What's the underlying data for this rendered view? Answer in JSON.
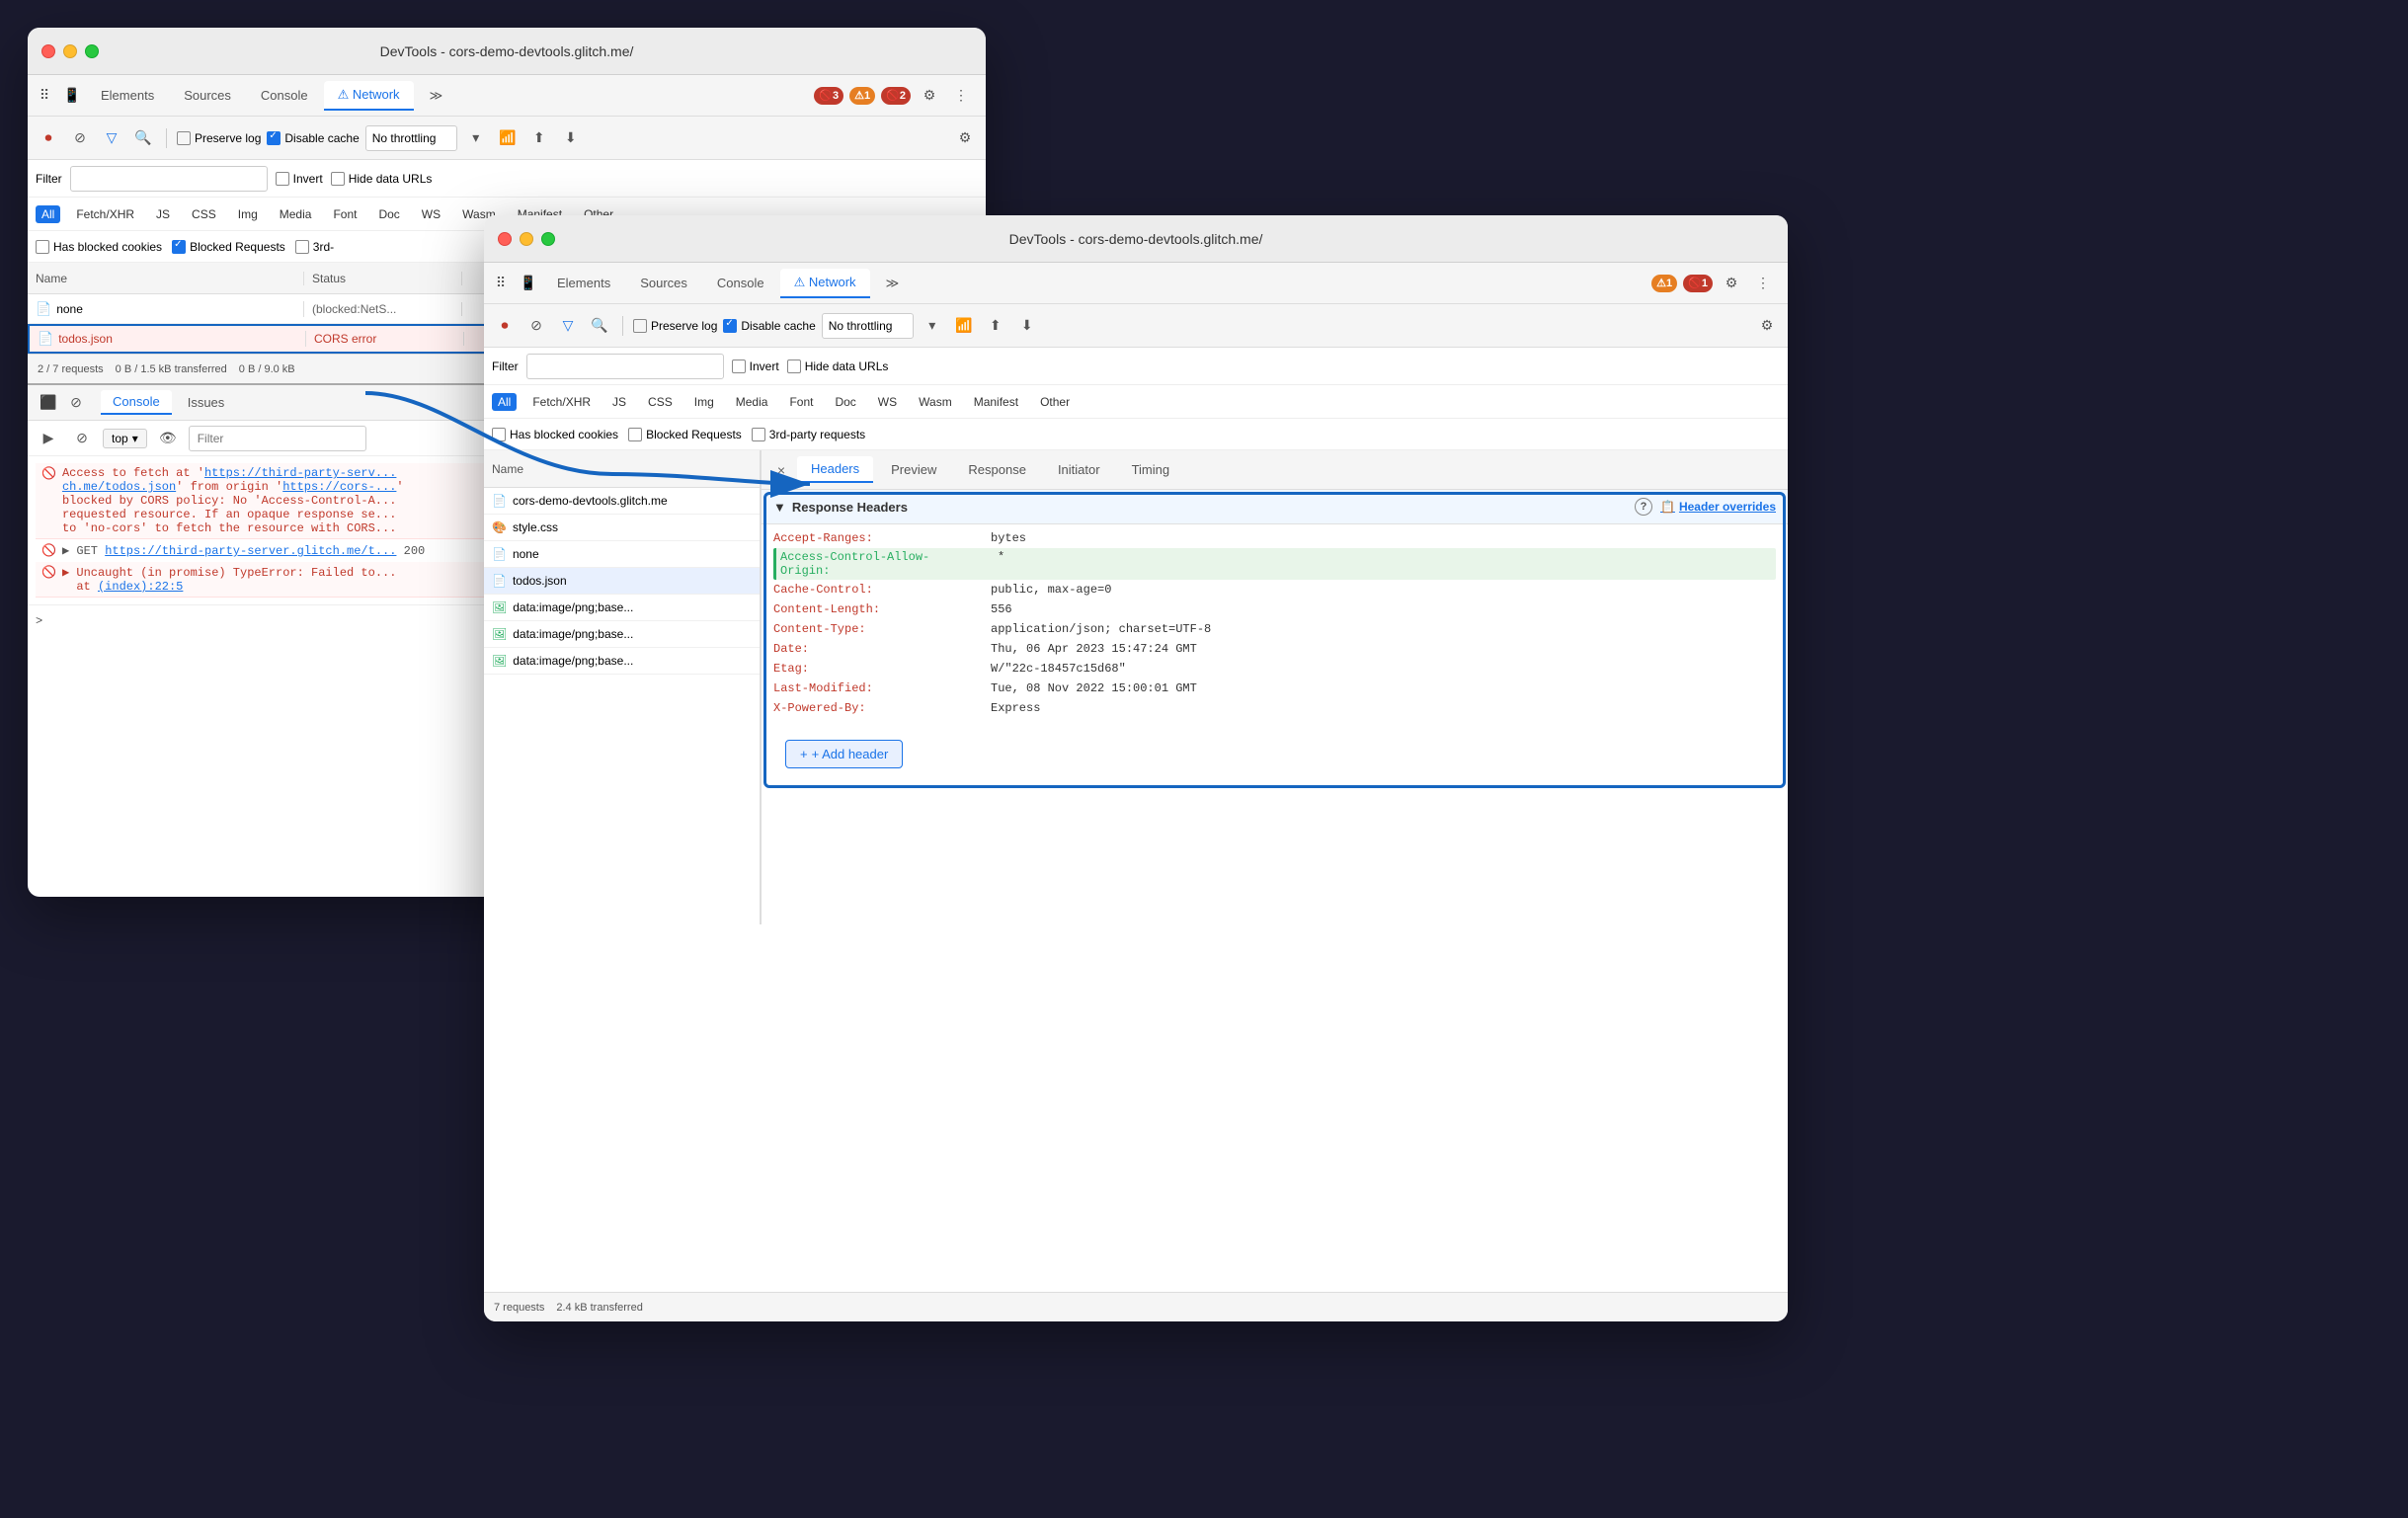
{
  "bg_window": {
    "title": "DevTools - cors-demo-devtools.glitch.me/",
    "tabs": [
      {
        "label": "Elements",
        "active": false
      },
      {
        "label": "Sources",
        "active": false
      },
      {
        "label": "Console",
        "active": false
      },
      {
        "label": "⚠ Network",
        "active": true
      },
      {
        "label": "≫",
        "active": false
      }
    ],
    "toolbar": {
      "preserve_log": "Preserve log",
      "disable_cache": "Disable cache",
      "throttle": "No throttling"
    },
    "badges": {
      "error": "3",
      "warning": "1",
      "blue": "2"
    },
    "filter_label": "Filter",
    "invert": "Invert",
    "hide_data_urls": "Hide data URLs",
    "type_filters": [
      "All",
      "Fetch/XHR",
      "JS",
      "CSS",
      "Img",
      "Media",
      "Font",
      "Doc",
      "WS",
      "Wasm",
      "Manifest",
      "Other"
    ],
    "active_type": "All",
    "has_blocked_cookies": "Has blocked cookies",
    "blocked_requests": "Blocked Requests",
    "third_party": "3rd-",
    "table_headers": {
      "name": "Name",
      "status": "Status"
    },
    "rows": [
      {
        "name": "none",
        "status": "(blocked:NetS...",
        "error": false,
        "highlighted": false,
        "icon": "📄"
      },
      {
        "name": "todos.json",
        "status": "CORS error",
        "error": true,
        "highlighted": true,
        "icon": "📄"
      }
    ],
    "status_bar": {
      "requests": "2 / 7 requests",
      "transferred": "0 B / 1.5 kB transferred",
      "resources": "0 B / 9.0 kB"
    },
    "console": {
      "tabs": [
        "Console",
        "Issues"
      ],
      "active_tab": "Console",
      "toolbar": {
        "top_label": "top",
        "filter_placeholder": "Filter"
      },
      "messages": [
        {
          "type": "error",
          "text": "Access to fetch at 'https://third-party-serv...',\nch.me/todos.json' from origin 'https://cors-...',\nblocked by CORS policy: No 'Access-Control-A...',\nrequested resource. If an opaque response se...',\nto 'no-cors' to fetch the resource with CORS..."
        },
        {
          "type": "success",
          "text": "▶ GET https://third-party-server.glitch.me/t... 200"
        },
        {
          "type": "error",
          "text": "▶ Uncaught (in promise) TypeError: Failed to...\n  at (index):22:5"
        }
      ],
      "input": "> "
    }
  },
  "fg_window": {
    "title": "DevTools - cors-demo-devtools.glitch.me/",
    "tabs": [
      {
        "label": "Elements",
        "active": false
      },
      {
        "label": "Sources",
        "active": false
      },
      {
        "label": "Console",
        "active": false
      },
      {
        "label": "⚠ Network",
        "active": true
      },
      {
        "label": "≫",
        "active": false
      }
    ],
    "badges": {
      "warning": "1",
      "error": "1"
    },
    "toolbar": {
      "preserve_log": "Preserve log",
      "disable_cache": "Disable cache",
      "throttle": "No throttling"
    },
    "filter_label": "Filter",
    "invert": "Invert",
    "hide_data_urls": "Hide data URLs",
    "type_filters": [
      "All",
      "Fetch/XHR",
      "JS",
      "CSS",
      "Img",
      "Media",
      "Font",
      "Doc",
      "WS",
      "Wasm",
      "Manifest",
      "Other"
    ],
    "active_type": "All",
    "has_blocked_cookies": "Has blocked cookies",
    "blocked_requests": "Blocked Requests",
    "third_party_requests": "3rd-party requests",
    "requests_list": [
      {
        "name": "cors-demo-devtools.glitch.me",
        "icon": "📄",
        "selected": false
      },
      {
        "name": "style.css",
        "icon": "🎨",
        "selected": false
      },
      {
        "name": "none",
        "icon": "📄",
        "selected": false
      },
      {
        "name": "todos.json",
        "icon": "📄",
        "selected": true
      },
      {
        "name": "data:image/png;base...",
        "icon": "🖼",
        "selected": false
      },
      {
        "name": "data:image/png;base...",
        "icon": "🖼",
        "selected": false
      },
      {
        "name": "data:image/png;base...",
        "icon": "🖼",
        "selected": false
      }
    ],
    "panel_tabs": [
      "Headers",
      "Preview",
      "Response",
      "Initiator",
      "Timing"
    ],
    "active_panel_tab": "Headers",
    "close_panel": "×",
    "response_headers": {
      "title": "▼ Response Headers",
      "overrides_label": "Header overrides",
      "headers": [
        {
          "name": "Accept-Ranges:",
          "value": "bytes",
          "highlight": false,
          "green": false
        },
        {
          "name": "Access-Control-Allow-Origin:",
          "value": "*",
          "highlight": true,
          "green": true
        },
        {
          "name": "Cache-Control:",
          "value": "public, max-age=0",
          "highlight": false,
          "green": false
        },
        {
          "name": "Content-Length:",
          "value": "556",
          "highlight": false,
          "green": false
        },
        {
          "name": "Content-Type:",
          "value": "application/json; charset=UTF-8",
          "highlight": false,
          "green": false
        },
        {
          "name": "Date:",
          "value": "Thu, 06 Apr 2023 15:47:24 GMT",
          "highlight": false,
          "green": false
        },
        {
          "name": "Etag:",
          "value": "W/\"22c-18457c15d68\"",
          "highlight": false,
          "green": false
        },
        {
          "name": "Last-Modified:",
          "value": "Tue, 08 Nov 2022 15:00:01 GMT",
          "highlight": false,
          "green": false
        },
        {
          "name": "X-Powered-By:",
          "value": "Express",
          "highlight": false,
          "green": false
        }
      ],
      "add_header_btn": "+ Add header"
    },
    "status_bar": {
      "requests": "7 requests",
      "transferred": "2.4 kB transferred"
    }
  },
  "highlight_boxes": {
    "bg_todos_row": true,
    "fg_response_headers": true
  },
  "arrow": {
    "description": "Arrow pointing from todos.json row to Headers panel"
  }
}
